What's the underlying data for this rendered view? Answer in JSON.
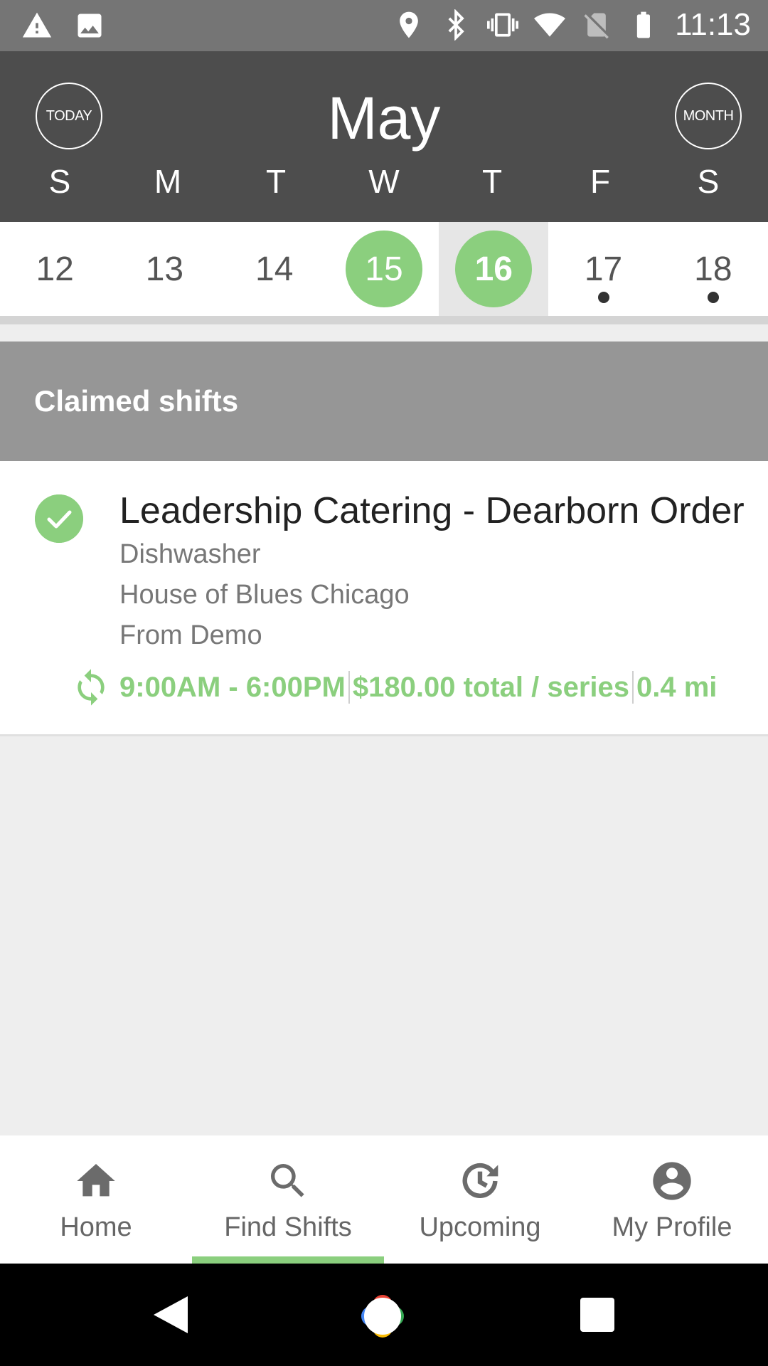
{
  "status_bar": {
    "time": "11:13",
    "icons": [
      "warning-icon",
      "image-icon",
      "location-icon",
      "bluetooth-icon",
      "vibrate-icon",
      "wifi-icon",
      "no-sim-icon",
      "battery-icon"
    ]
  },
  "calendar": {
    "today_label": "TODAY",
    "month_label": "May",
    "month_button_label": "MONTH",
    "weekdays": [
      "S",
      "M",
      "T",
      "W",
      "T",
      "F",
      "S"
    ],
    "dates": [
      {
        "num": "12",
        "selected": false,
        "has_event": false
      },
      {
        "num": "13",
        "selected": false,
        "has_event": false
      },
      {
        "num": "14",
        "selected": false,
        "has_event": false
      },
      {
        "num": "15",
        "selected": true,
        "has_event": false
      },
      {
        "num": "16",
        "selected": true,
        "current": true,
        "has_event": false
      },
      {
        "num": "17",
        "selected": false,
        "has_event": true
      },
      {
        "num": "18",
        "selected": false,
        "has_event": true
      }
    ]
  },
  "section": {
    "title": "Claimed shifts"
  },
  "shift": {
    "title": "Leadership Catering - Dearborn Order",
    "role": "Dishwasher",
    "venue": "House of Blues Chicago",
    "source": "From Demo",
    "time_range": "9:00AM - 6:00PM",
    "pay": "$180.00 total / series",
    "distance": "0.4 mi"
  },
  "bottom_nav": {
    "items": [
      {
        "label": "Home",
        "icon": "home-icon"
      },
      {
        "label": "Find Shifts",
        "icon": "search-icon",
        "active": true
      },
      {
        "label": "Upcoming",
        "icon": "upcoming-clock-icon"
      },
      {
        "label": "My Profile",
        "icon": "profile-icon"
      }
    ]
  },
  "colors": {
    "accent": "#8bcf7e",
    "header": "#4d4d4d",
    "section": "#969696"
  }
}
